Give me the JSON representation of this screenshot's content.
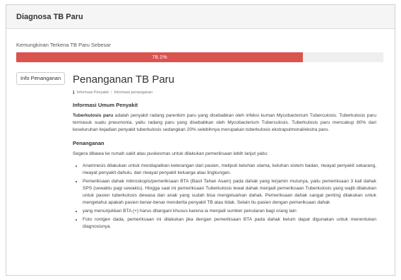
{
  "panel": {
    "title": "Diagnosa TB Paru",
    "probability_label": "Kemungkinan Terkena TB Paru Sebesar",
    "probability_value": "78.1%",
    "probability_fraction": 0.781,
    "bar_color": "#d9534f"
  },
  "sidebar_button": "Info Penanganan",
  "content": {
    "title": "Penanganan TB Paru",
    "breadcrumb": [
      "Informasi Penyakit",
      "Informasi penanganan"
    ],
    "info_heading": "Informasi Umum Penyakit",
    "info_bold": "Tuberkulosis paru",
    "info_text": " adalah penyakit radang parenkim paru yang disebabkan oleh infeksi kuman Mycobacterium Tuberculosis. Tuberkulosis paru termasuk suatu pneumonia, yaitu radang paru yang disebabkan oleh Mycobacterium Tuberculosis. Tuberkulosis paru mencakup 80% dari keseluruhan kejadian penyakit tuberkulosis sedangkan 20% selebihnya merupakan tuberkulosis ekstrapulmonal/ekstra paru.",
    "handling_heading": "Penanganan",
    "handling_intro": "Segera dibawa ke rumah sakit atau puskesmas untuk dilakukan pemeriksaan lebih lanjut yaitu:",
    "steps": [
      "Anamnesis dilakukan untuk mendapatkan keterangan dari pasien, meliputi keluhan utama, keluhan sistem badan, riwayat penyakit sekarang, riwayat penyakit dahulu, dan riwayat penyakit keluarga atau lingkungan.",
      "Pemeriksaan dahak mikroskopis/pemeriksaan BTA (Basil Tahan Asam) pada dahak yang terjamin mutunya, yaitu pemeriksaan 3 kali dahak SPS (sewaktu pagi sewaktu). Hingga saat ini pemeriksaan Tuberkulosis lewat dahak menjadi pemeriksaan Tuberkulosis yang wajib dilakukan untuk pasien tuberkulosis dewasa dan anak yang sudah bisa mengeluarkan dahak. Pemeriksaan dahak sangat penting dilakukan untuk mengetahui apakah pasien benar-benar menderita penyakit TB atau tidak. Selain itu pasien dengan pemeriksaan dahak",
      "yang menunjukkan BTA (+) harus ditangani khusus karena ia menjadi sumber penularan bagi orang lain",
      "Foto rontgen dada, pemeriksaan ini dilakukan jika dengan pemeriksaan BTA pada dahak belum dapat digunakan untuk menentukan diagnosisnya."
    ]
  }
}
